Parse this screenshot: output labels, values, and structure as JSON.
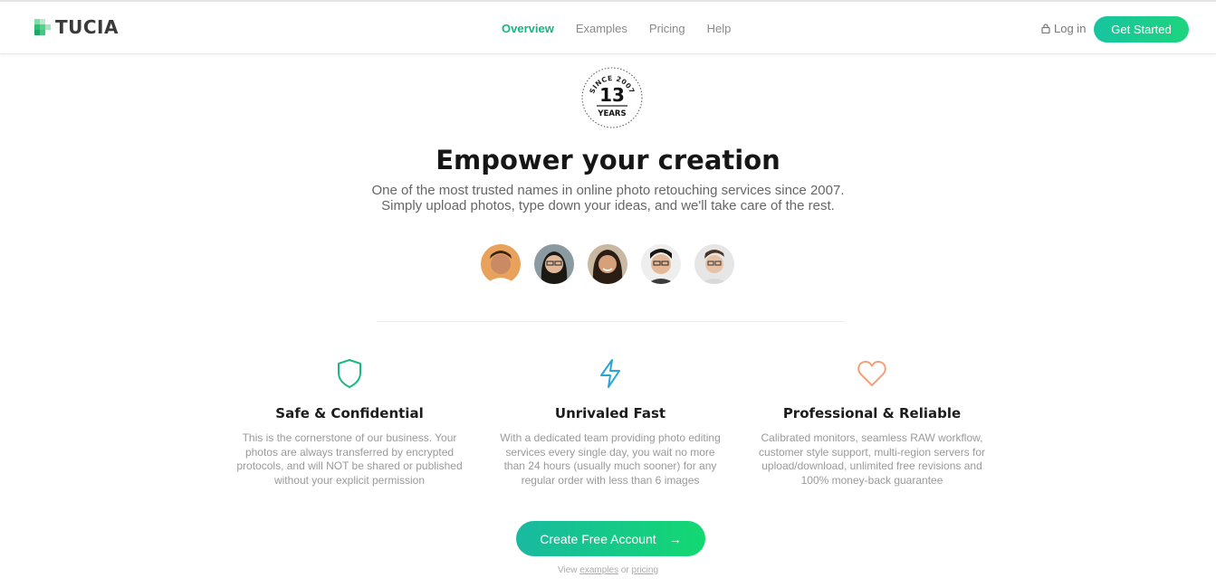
{
  "header": {
    "brand": "TUCIA",
    "nav": [
      {
        "label": "Overview",
        "active": true
      },
      {
        "label": "Examples",
        "active": false
      },
      {
        "label": "Pricing",
        "active": false
      },
      {
        "label": "Help",
        "active": false
      }
    ],
    "login_label": "Log in",
    "cta_label": "Get Started"
  },
  "badge": {
    "top_text": "SINCE 2007",
    "number": "13",
    "bottom_text": "YEARS"
  },
  "hero": {
    "headline": "Empower your creation",
    "subtitle_line1": "One of the most trusted names in online photo retouching services since 2007.",
    "subtitle_line2": "Simply upload photos, type down your ideas, and we'll take care of the rest."
  },
  "avatars": [
    {
      "name": "avatar-1"
    },
    {
      "name": "avatar-2"
    },
    {
      "name": "avatar-3"
    },
    {
      "name": "avatar-4"
    },
    {
      "name": "avatar-5"
    }
  ],
  "features": [
    {
      "icon": "shield-icon",
      "color": "#19b882",
      "title": "Safe & Confidential",
      "text": "This is the cornerstone of our business. Your photos are always transferred by encrypted protocols, and will NOT be shared or published without your explicit permission"
    },
    {
      "icon": "lightning-icon",
      "color": "#2aa6d6",
      "title": "Unrivaled Fast",
      "text": "With a dedicated team providing photo editing services every single day, you wait no more than 24 hours (usually much sooner) for any regular order with less than 6 images"
    },
    {
      "icon": "heart-icon",
      "color": "#f4a07a",
      "title": "Professional & Reliable",
      "text": "Calibrated monitors, seamless RAW workflow, customer style support, multi-region servers for upload/download, unlimited free revisions and 100% money-back guarantee"
    }
  ],
  "cta": {
    "label": "Create Free Account",
    "view_prefix": "View",
    "view_link1": "examples",
    "view_mid": "or",
    "view_link2": "pricing"
  },
  "colors": {
    "accent": "#18b57e",
    "button_gradient_start": "#17c4a0",
    "button_gradient_end": "#1ed47e"
  }
}
